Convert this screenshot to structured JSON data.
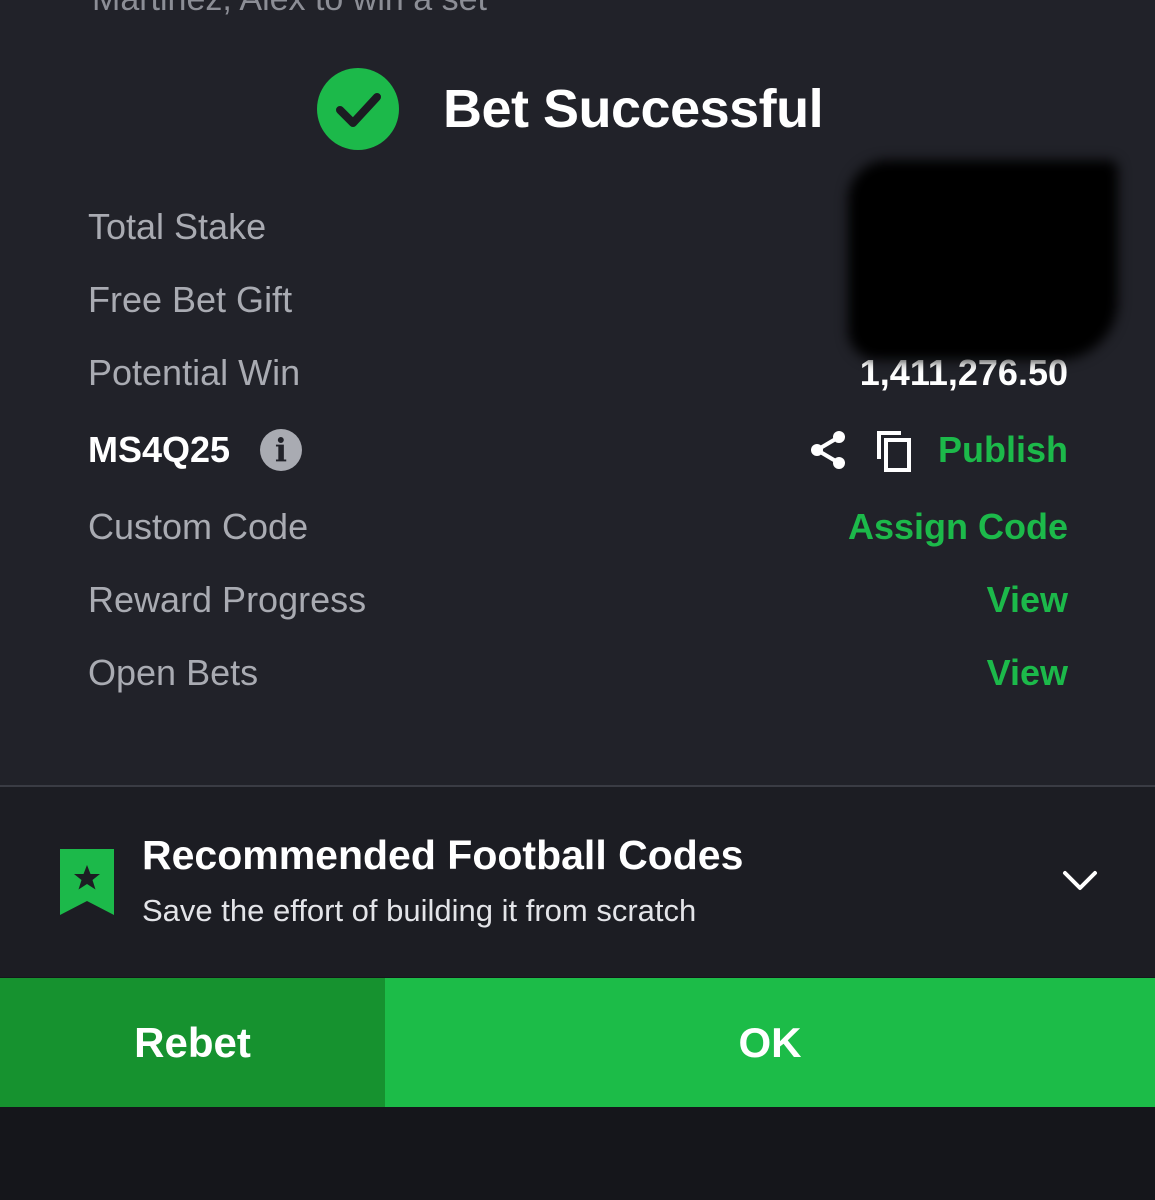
{
  "top_cut_text": "Martinez, Alex to win a set",
  "header": {
    "title": "Bet Successful",
    "icon": "check-circle-icon",
    "icon_color": "#1cb94a"
  },
  "summary": {
    "total_stake_label": "Total Stake",
    "free_bet_gift_label": "Free Bet Gift",
    "potential_win_label": "Potential Win",
    "potential_win_value": "1,411,276.50"
  },
  "booking": {
    "code": "MS4Q25",
    "info_icon": "i",
    "publish_label": "Publish"
  },
  "custom_code": {
    "label": "Custom Code",
    "action": "Assign Code"
  },
  "reward_progress": {
    "label": "Reward Progress",
    "action": "View"
  },
  "open_bets": {
    "label": "Open Bets",
    "action": "View"
  },
  "recommended": {
    "title": "Recommended Football Codes",
    "subtitle": "Save the effort of building it from scratch",
    "icon": "bookmark-star-icon"
  },
  "buttons": {
    "rebet": "Rebet",
    "ok": "OK"
  },
  "colors": {
    "accent_green": "#1cb94a",
    "rebet_green": "#16922f",
    "ok_green": "#1cbc48",
    "panel_bg": "#212229"
  }
}
